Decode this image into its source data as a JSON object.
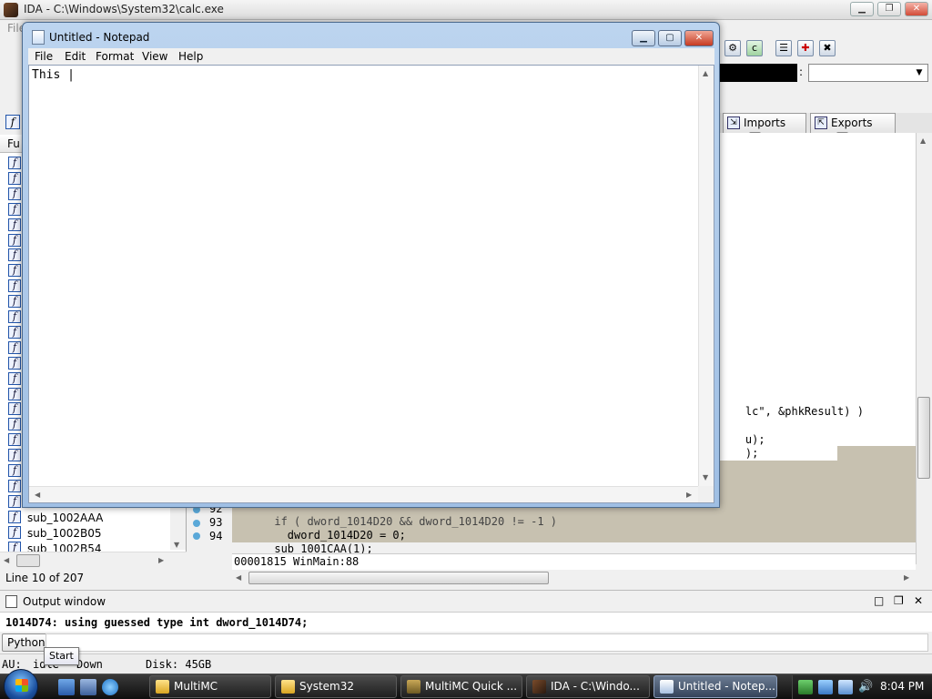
{
  "ida": {
    "title": "IDA - C:\\Windows\\System32\\calc.exe",
    "menu_partial": "File",
    "tabs": [
      {
        "label": "Imports"
      },
      {
        "label": "Exports"
      }
    ],
    "code_lines": [
      {
        "text": "lc\", &phkResult) )"
      },
      {
        "text": "u);"
      },
      {
        "text": ");"
      },
      {
        "text": "  if ( dword_1014D20 && dword_1014D20 != -1 )"
      },
      {
        "text": "    dword_1014D20 = 0;"
      },
      {
        "text": "  sub_1001CAA(1);"
      }
    ],
    "line_numbers": [
      "92",
      "93",
      "94"
    ],
    "location": "00001815 WinMain:88",
    "functions_header": "Fu",
    "functions": [
      {
        "name": "sub_1002AAA"
      },
      {
        "name": "sub_1002B05"
      },
      {
        "name": "sub_1002B54"
      }
    ],
    "line_count": "Line 10 of 207",
    "output": {
      "title": "Output window",
      "line": "1014D74: using guessed type int dword_1014D74;",
      "python_label": "Python"
    },
    "status": {
      "au": "AU:",
      "state": "idle",
      "direction": "Down",
      "disk": "Disk: 45GB"
    }
  },
  "tooltip": "Start",
  "notepad": {
    "title": "Untitled - Notepad",
    "menu": [
      "File",
      "Edit",
      "Format",
      "View",
      "Help"
    ],
    "content": "This |"
  },
  "taskbar": {
    "buttons": [
      {
        "label": "MultiMC"
      },
      {
        "label": "System32"
      },
      {
        "label": "MultiMC Quick ..."
      },
      {
        "label": "IDA - C:\\Windo..."
      },
      {
        "label": "Untitled - Notep..."
      }
    ],
    "clock": "8:04 PM"
  },
  "colors": {
    "ida_code_bg": "#c7c1b0",
    "identifier_blue": "#000080",
    "taskbar": "#1a1a1a"
  }
}
